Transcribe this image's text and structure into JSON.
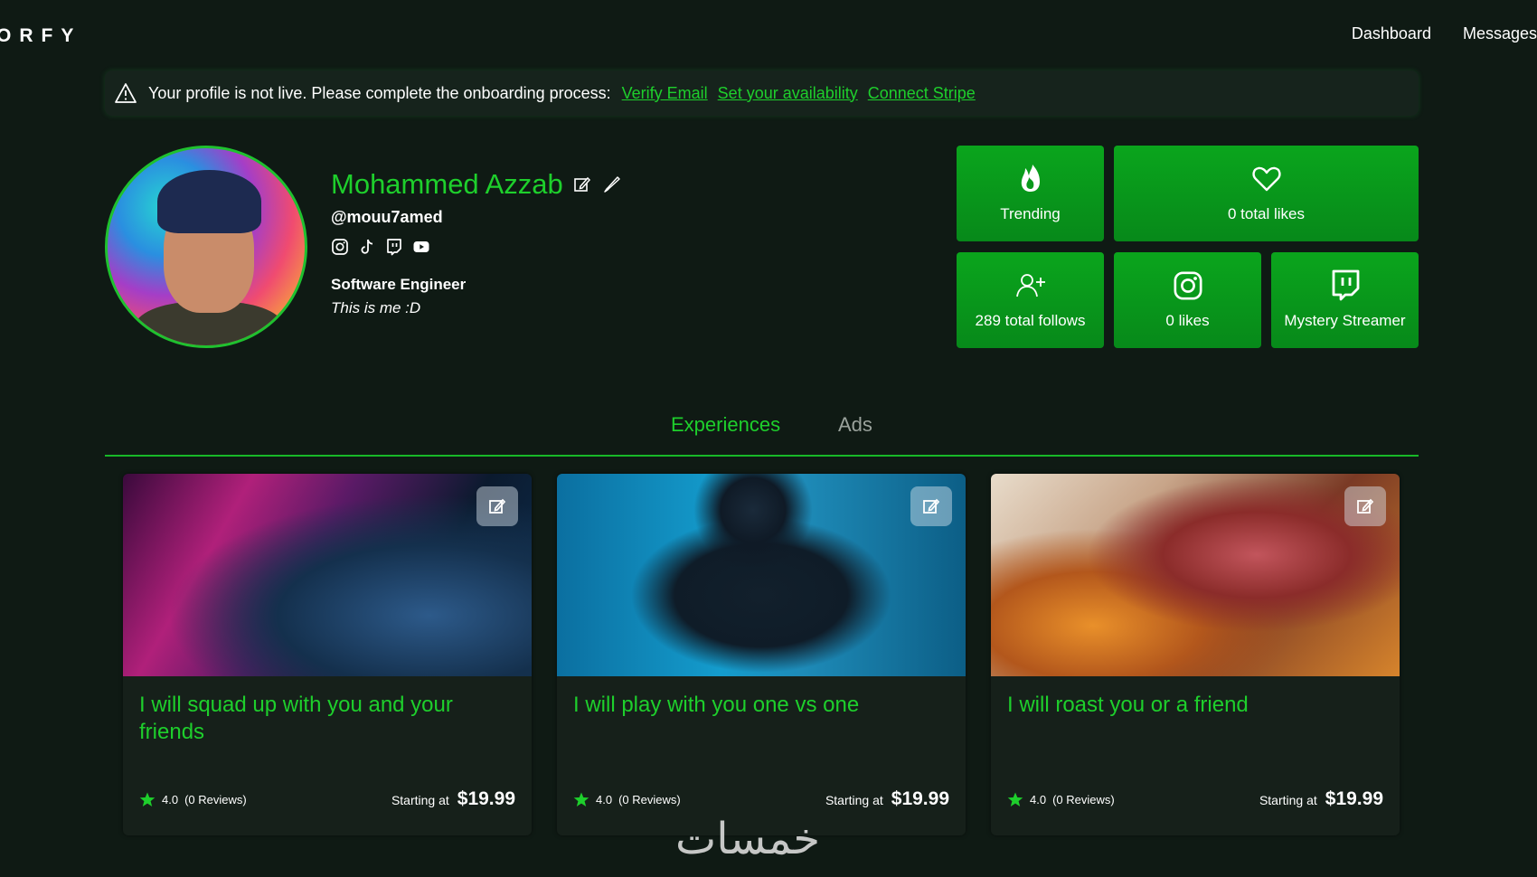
{
  "header": {
    "logo": "ORFY",
    "nav": [
      "Dashboard",
      "Messages"
    ]
  },
  "alert": {
    "message": "Your profile is not live. Please complete the onboarding process:",
    "links": [
      "Verify Email",
      "Set your availability",
      "Connect Stripe"
    ]
  },
  "profile": {
    "name": "Mohammed Azzab",
    "handle": "@mouu7amed",
    "socials": [
      "instagram-icon",
      "tiktok-icon",
      "twitch-icon",
      "youtube-icon"
    ],
    "title": "Software Engineer",
    "bio": "This is me :D"
  },
  "stats": [
    {
      "icon": "flame-icon",
      "label": "Trending"
    },
    {
      "icon": "heart-icon",
      "label": "0 total likes"
    },
    {
      "icon": "add-user-icon",
      "label": "289 total follows"
    },
    {
      "icon": "instagram-icon",
      "label": "0 likes"
    },
    {
      "icon": "twitch-icon",
      "label": "Mystery Streamer"
    }
  ],
  "tabs": [
    "Experiences",
    "Ads"
  ],
  "cards": [
    {
      "title": "I will squad up with you and your friends",
      "rating": "4.0",
      "reviews": "(0 Reviews)",
      "price_label": "Starting at",
      "price": "$19.99"
    },
    {
      "title": "I will play with you one vs one",
      "rating": "4.0",
      "reviews": "(0 Reviews)",
      "price_label": "Starting at",
      "price": "$19.99"
    },
    {
      "title": "I will roast you or a friend",
      "rating": "4.0",
      "reviews": "(0 Reviews)",
      "price_label": "Starting at",
      "price": "$19.99"
    }
  ],
  "colors": {
    "accent": "#1ecf2c",
    "background": "#0f1a14",
    "card": "#16201a",
    "stat": "#0aa51c"
  },
  "watermark": "خمسات"
}
